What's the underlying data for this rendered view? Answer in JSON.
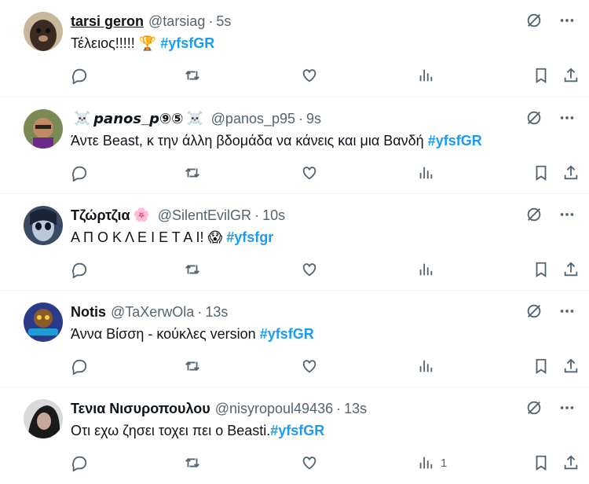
{
  "tweets": [
    {
      "name": "tarsi geron",
      "name_emoji_before": "",
      "name_emoji_after": "",
      "handle": "@tarsiag",
      "separator": "·",
      "time": "5s",
      "text": "Τέλειος!!!!! 🏆",
      "hashtag": "#yfsfGR",
      "views": "",
      "avatar_color": "#3a2a22"
    },
    {
      "name": "𝙥𝙖𝙣𝙤𝙨_𝙥⑨⑤",
      "name_emoji_before": "☠️",
      "name_emoji_after": "☠️",
      "handle": "@panos_p95",
      "separator": "·",
      "time": "9s",
      "text": "Άντε Beast, κ την άλλη βδομάδα  να κάνεις και μια Βανδή",
      "hashtag": "#yfsfGR",
      "views": "",
      "avatar_color": "#5c6b3a"
    },
    {
      "name": "Τζώρτζια",
      "name_emoji_before": "",
      "name_emoji_after": "🌸",
      "handle": "@SilentEvilGR",
      "separator": "·",
      "time": "10s",
      "text": "Α Π Ο Κ Λ Ε Ι Ε Τ Α Ι!  😱",
      "hashtag": "#yfsfgr",
      "views": "",
      "avatar_color": "#4a5f7a"
    },
    {
      "name": "Notis",
      "name_emoji_before": "",
      "name_emoji_after": "",
      "handle": "@TaXerwOla",
      "separator": "·",
      "time": "13s",
      "text": "Άννα Βίσση - κούκλες version",
      "hashtag": "#yfsfGR",
      "views": "",
      "avatar_color": "#2c3a8a"
    },
    {
      "name": "Τενια Νισυροπουλου",
      "name_emoji_before": "",
      "name_emoji_after": "",
      "handle": "@nisyropoul49436",
      "separator": "·",
      "time": "13s",
      "text": "Οτι εχω ζησει τοχει πει ο Beasti.",
      "hashtag": "#yfsfGR",
      "views": "1",
      "avatar_color": "#2a2a2a"
    }
  ],
  "colors": {
    "accent": "#1d9bf0",
    "secondary_text": "#536471",
    "divider": "#eff3f4"
  },
  "icons": [
    "grok-icon",
    "more-icon",
    "reply-icon",
    "retweet-icon",
    "like-icon",
    "views-icon",
    "bookmark-icon",
    "share-icon"
  ]
}
